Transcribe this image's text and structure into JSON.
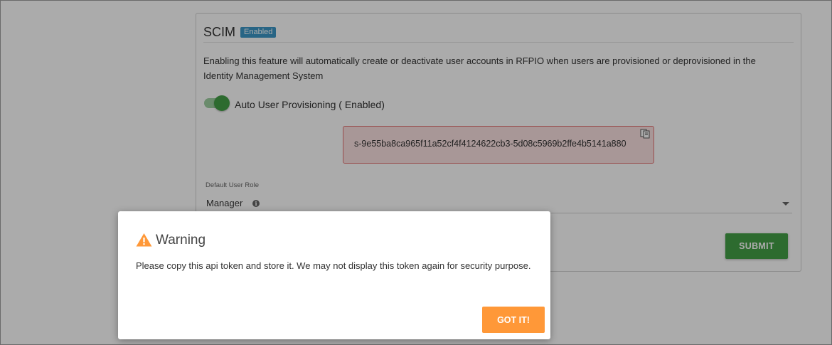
{
  "scim": {
    "title": "SCIM",
    "status_badge": "Enabled",
    "description": "Enabling this feature will automatically create or deactivate user accounts in RFPIO when users are provisioned or deprovisioned in the Identity Management System",
    "auto_provisioning": {
      "label": "Auto User Provisioning ( Enabled)",
      "enabled": true
    },
    "api_token": "s-9e55ba8ca965f11a52cf4f4124622cb3-5d08c5969b2ffe4b5141a880",
    "default_role": {
      "label": "Default User Role",
      "value": "Manager"
    },
    "submit_label": "SUBMIT"
  },
  "modal": {
    "title": "Warning",
    "message": "Please copy this api token and store it. We may not display this token again for security purpose.",
    "button_label": "GOT IT!"
  },
  "colors": {
    "badge": "#3c97c6",
    "toggle_on": "#43a047",
    "submit": "#43a047",
    "token_bg": "#fbe1e1",
    "token_border": "#e57373",
    "warning": "#ff9838",
    "got_it": "#ff9838"
  },
  "icons": {
    "copy": "copy-icon",
    "info": "info-icon",
    "dropdown": "chevron-down-icon",
    "warning": "warning-triangle-icon"
  }
}
